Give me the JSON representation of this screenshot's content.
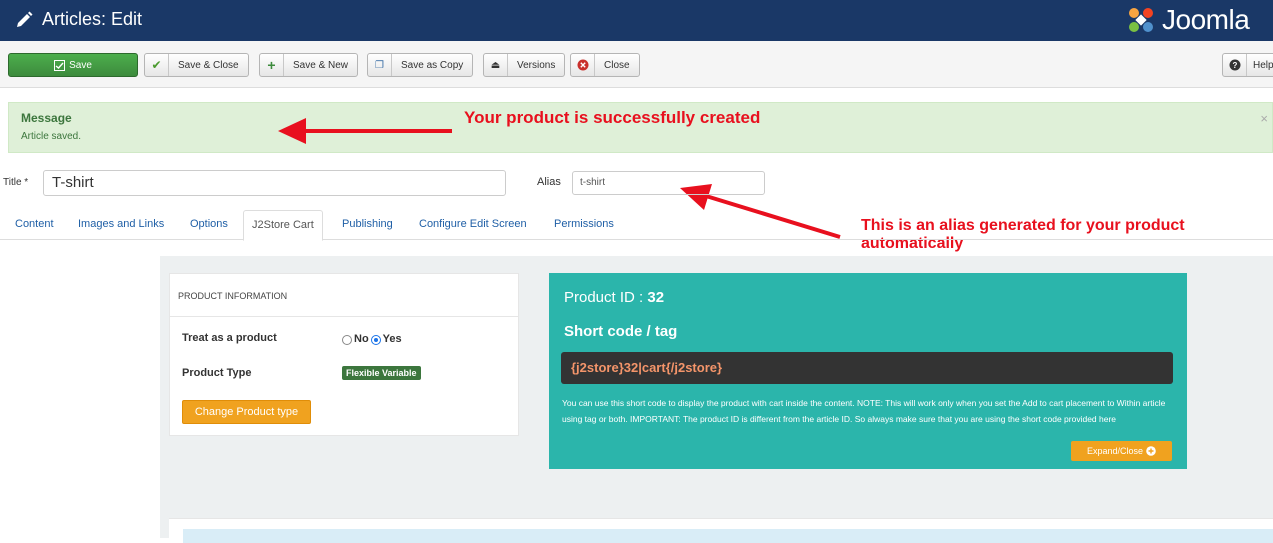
{
  "header": {
    "title": "Articles: Edit",
    "logo_text": "Joomla"
  },
  "toolbar": {
    "save": "Save",
    "save_close": "Save & Close",
    "save_new": "Save & New",
    "save_copy": "Save as Copy",
    "versions": "Versions",
    "close": "Close",
    "help": "Help"
  },
  "message": {
    "title": "Message",
    "text": "Article saved.",
    "close": "×"
  },
  "annotations": {
    "success": "Your product is successfully created",
    "alias_line1": "This is an alias generated for your product",
    "alias_line2": "automatically"
  },
  "form": {
    "title_label": "Title *",
    "title_value": "T-shirt",
    "alias_label": "Alias",
    "alias_value": "t-shirt"
  },
  "tabs": [
    "Content",
    "Images and Links",
    "Options",
    "J2Store Cart",
    "Publishing",
    "Configure Edit Screen",
    "Permissions"
  ],
  "product_info": {
    "heading": "PRODUCT INFORMATION",
    "treat_label": "Treat as a product",
    "no": "No",
    "yes": "Yes",
    "type_label": "Product Type",
    "type_badge": "Flexible Variable",
    "change_btn": "Change Product type"
  },
  "shortcode": {
    "pid_label": "Product ID : ",
    "pid_value": "32",
    "title": "Short code / tag",
    "code": "{j2store}32|cart{/j2store}",
    "note": "You can use this short code to display the product with cart inside the content. NOTE: This will work only when you set the Add to cart placement to Within article using tag or both. IMPORTANT: The product ID is different from the article ID. So always make sure that you are using the short code provided here",
    "expand": "Expand/Close"
  },
  "colors": {
    "header": "#1a3867",
    "save": "#46a546",
    "success_bg": "#dff0d8",
    "teal": "#2bb5ab",
    "orange": "#f0a21f",
    "annotation": "#e8101e"
  }
}
